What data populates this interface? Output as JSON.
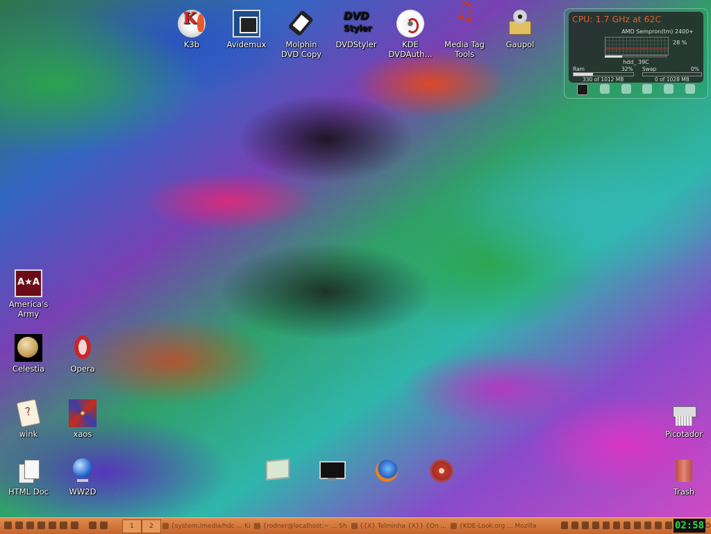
{
  "desktop_icons": {
    "k3b": "K3b",
    "avidemux": "Avidemux",
    "molphin_1": "Molphin",
    "molphin_2": "DVD Copy",
    "dvdstyler": "DVDStyler",
    "kde_1": "KDE",
    "kde_2": "DVDAuth...",
    "mediatag_1": "Media Tag",
    "mediatag_2": "Tools",
    "gaupol": "Gaupol",
    "army_1": "America's",
    "army_2": "Army",
    "celestia": "Celestia",
    "opera": "Opera",
    "wink": "wink",
    "xaos": "xaos",
    "htmldoc": "HTML Doc",
    "ww2d": "WW2D",
    "picotador": "Picotador",
    "trash": "Trash"
  },
  "sysmon": {
    "cpu_title": "CPU: 1.7 GHz at 62C",
    "cpu_model": "AMD Sempron(tm) 2400+",
    "cpu_load": 0.28,
    "cpu_pct": "28 %",
    "hdd": "hdd_ 39C",
    "ram_label": "Ram",
    "ram_pct": "32%",
    "ram_fraction": 0.32,
    "swap_label": "Swap",
    "swap_pct": "0%",
    "swap_fraction": 0,
    "ram_used": "330 of 1012 MB",
    "swap_used": "0 of 1028 MB"
  },
  "taskbar": {
    "pager": [
      "1",
      "2"
    ],
    "tasks": [
      "{system:/media/hdc ... Ki",
      "{rodner@localhost:~ ... Sh",
      "{{X} Telminha {X}} {On ...",
      "{KDE-Look.org ... Mozilla"
    ],
    "clock": "02:58"
  },
  "colors": {
    "taskbar": "#d27a3e",
    "clock_text": "#2bd94a",
    "cpu_title": "#e0632a"
  }
}
